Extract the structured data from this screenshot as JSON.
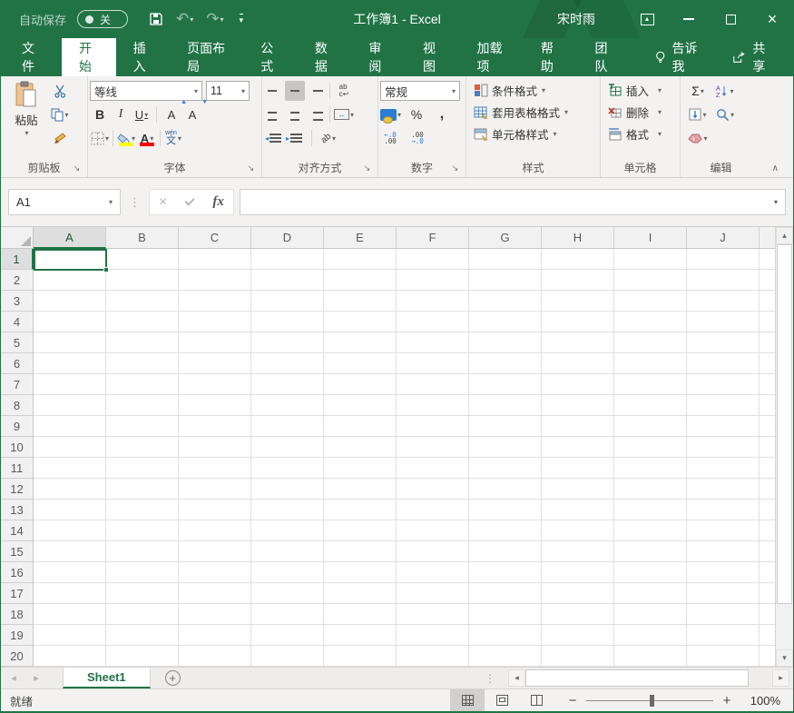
{
  "window": {
    "title": "工作簿1 - Excel",
    "user": "宋时雨"
  },
  "quick_access": {
    "autosave_label": "自动保存",
    "autosave_state": "关"
  },
  "ribbon_tabs": {
    "file": "文件",
    "items": [
      "开始",
      "插入",
      "页面布局",
      "公式",
      "数据",
      "审阅",
      "视图",
      "加载项",
      "帮助",
      "团队"
    ],
    "active": "开始",
    "tell_me": "告诉我",
    "share": "共享"
  },
  "ribbon": {
    "clipboard": {
      "label": "剪贴板",
      "paste": "粘贴"
    },
    "font": {
      "label": "字体",
      "name": "等线",
      "size": "11",
      "bold": "B",
      "italic": "I",
      "underline": "U",
      "phonetic_ruby": "wén",
      "phonetic": "文"
    },
    "alignment": {
      "label": "对齐方式",
      "wrap_top": "ab",
      "wrap_bottom": "c↩",
      "orientation": "ab"
    },
    "number": {
      "label": "数字",
      "format": "常规",
      "percent": "%",
      "comma": ",",
      "inc_top": "←.0",
      "inc_bottom": ".00",
      "dec_top": ".00",
      "dec_bottom": "→.0"
    },
    "styles": {
      "label": "样式",
      "conditional": "条件格式",
      "format_table": "套用表格格式",
      "cell_styles": "单元格样式"
    },
    "cells": {
      "label": "单元格",
      "insert": "插入",
      "delete": "删除",
      "format": "格式"
    },
    "editing": {
      "label": "编辑",
      "autosum": "Σ"
    }
  },
  "formula_bar": {
    "name_box": "A1",
    "fx": "fx",
    "value": ""
  },
  "grid": {
    "columns": [
      "A",
      "B",
      "C",
      "D",
      "E",
      "F",
      "G",
      "H",
      "I",
      "J"
    ],
    "row_count": 20,
    "selected_cell": "A1",
    "selected_column": "A",
    "selected_row": "1"
  },
  "sheet_bar": {
    "tabs": [
      "Sheet1"
    ],
    "active_tab": "Sheet1"
  },
  "status_bar": {
    "status": "就绪",
    "zoom_level": "100%"
  },
  "colors": {
    "accent": "#217346",
    "ribbon_bg": "#f3f2f1",
    "selection": "#217346",
    "fill_color_swatch": "#ffff00",
    "font_color_swatch": "#ff0000"
  }
}
